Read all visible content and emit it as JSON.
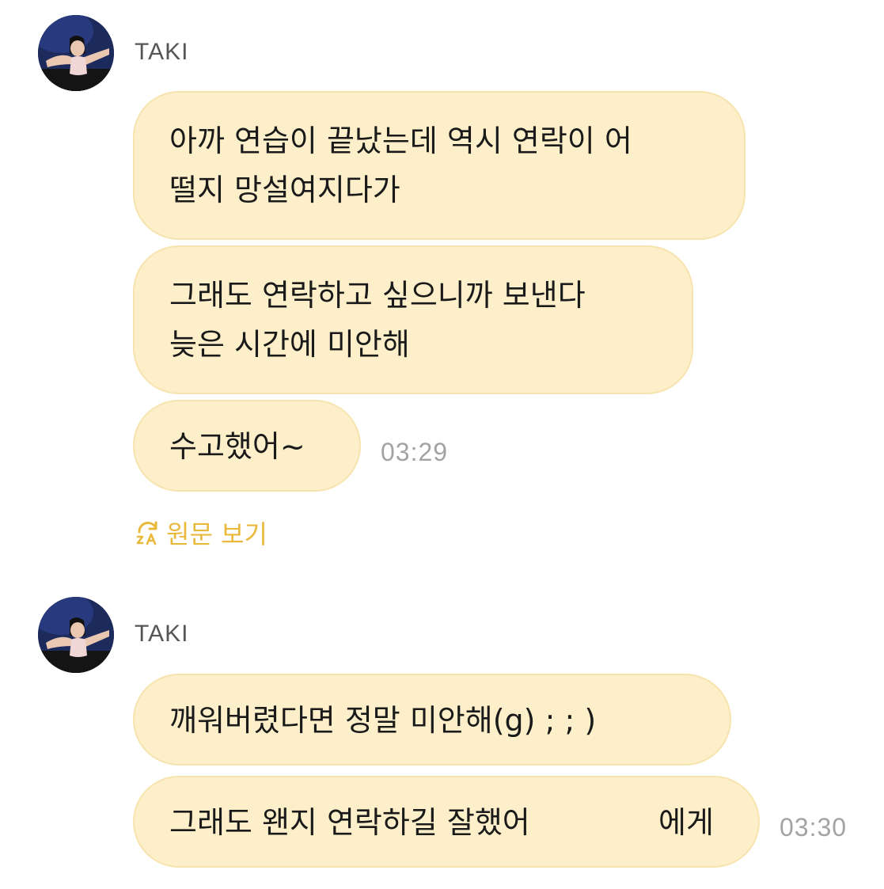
{
  "colors": {
    "bubble": "#fcefc9",
    "bubble_border": "#f7e3ad",
    "accent": "#e8b93c",
    "timestamp": "#a3a3a3",
    "sender": "#555555"
  },
  "groups": [
    {
      "sender": "TAKI",
      "messages": [
        {
          "lines": [
            "아까 연습이 끝났는데 역시 연락이 어",
            "떨지 망설여지다가"
          ]
        },
        {
          "lines": [
            "그래도 연락하고 싶으니까 보낸다",
            "늦은 시간에 미안해"
          ]
        },
        {
          "lines": [
            "수고했어~"
          ]
        }
      ],
      "time": "03:29",
      "translate_icon": "translate-refresh-icon",
      "translate_label": "원문 보기"
    },
    {
      "sender": "TAKI",
      "messages": [
        {
          "lines": [
            "깨워버렸다면 정말 미안해(g) ; ; )"
          ]
        },
        {
          "lines": [
            "그래도 왠지 연락하길 잘했어",
            "에게"
          ]
        }
      ],
      "time": "03:30"
    }
  ]
}
